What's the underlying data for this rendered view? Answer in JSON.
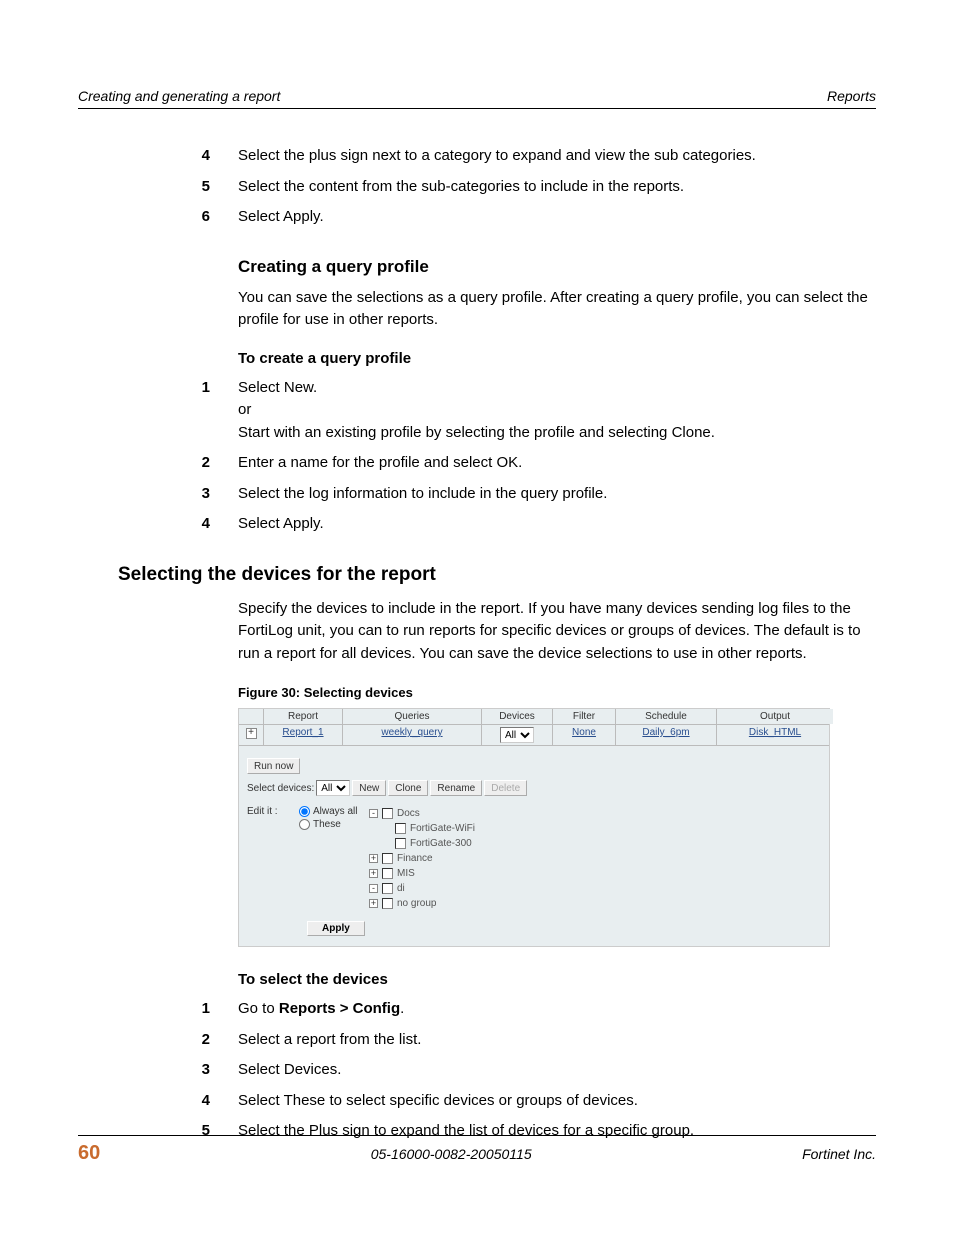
{
  "header": {
    "left": "Creating and generating a report",
    "right": "Reports"
  },
  "steps_top": [
    {
      "n": "4",
      "text": "Select the plus sign next to a category to expand and view the sub categories."
    },
    {
      "n": "5",
      "text": "Select the content from the sub-categories to include in the reports."
    },
    {
      "n": "6",
      "text": "Select Apply."
    }
  ],
  "sub1": {
    "title": "Creating a query profile",
    "para": "You can save the selections as a query profile. After creating a query profile, you can select the profile for use in other reports.",
    "proc_title": "To create a query profile",
    "steps": [
      {
        "n": "1",
        "line1": "Select New.",
        "line2": "or",
        "line3": "Start with an existing profile by selecting the profile and selecting Clone."
      },
      {
        "n": "2",
        "line1": "Enter a name for the profile and select OK."
      },
      {
        "n": "3",
        "line1": "Select the log information to include in the query profile."
      },
      {
        "n": "4",
        "line1": "Select Apply."
      }
    ]
  },
  "section": {
    "title": "Selecting the devices for the report",
    "para": "Specify the devices to include in the report. If you have many devices sending log files to the FortiLog unit, you can to run reports for specific devices or groups of devices. The default is to run a report for all devices. You can save the device selections to use in other reports."
  },
  "figure": {
    "caption": "Figure 30: Selecting devices",
    "headers": [
      "Report",
      "Queries",
      "Devices",
      "Filter",
      "Schedule",
      "Output"
    ],
    "row": {
      "report": "Report_1",
      "queries": "weekly_query",
      "devices": "All",
      "filter": "None",
      "schedule": "Daily_6pm",
      "output": "Disk_HTML"
    },
    "run_now": "Run now",
    "select_devices_label": "Select devices:",
    "select_devices_value": "All",
    "buttons": {
      "new": "New",
      "clone": "Clone",
      "rename": "Rename",
      "delete": "Delete"
    },
    "edit_label": "Edit it :",
    "always_all": "Always all",
    "these": "These",
    "tree": [
      {
        "expand": "-",
        "indent": 0,
        "label": "Docs"
      },
      {
        "expand": "",
        "indent": 1,
        "label": "FortiGate-WiFi"
      },
      {
        "expand": "",
        "indent": 1,
        "label": "FortiGate-300"
      },
      {
        "expand": "+",
        "indent": 0,
        "label": "Finance"
      },
      {
        "expand": "+",
        "indent": 0,
        "label": "MIS"
      },
      {
        "expand": "-",
        "indent": 0,
        "label": "di"
      },
      {
        "expand": "+",
        "indent": 0,
        "label": "no group"
      }
    ],
    "apply": "Apply"
  },
  "proc2": {
    "title": "To select the devices",
    "steps": [
      {
        "n": "1",
        "pre": "Go to ",
        "bold": "Reports > Config",
        "post": "."
      },
      {
        "n": "2",
        "text": "Select a report from the list."
      },
      {
        "n": "3",
        "text": "Select Devices."
      },
      {
        "n": "4",
        "text": "Select These to select specific devices or groups of devices."
      },
      {
        "n": "5",
        "text": "Select the Plus sign to expand the list of devices for a specific group."
      }
    ]
  },
  "footer": {
    "page": "60",
    "mid": "05-16000-0082-20050115",
    "right": "Fortinet Inc."
  }
}
